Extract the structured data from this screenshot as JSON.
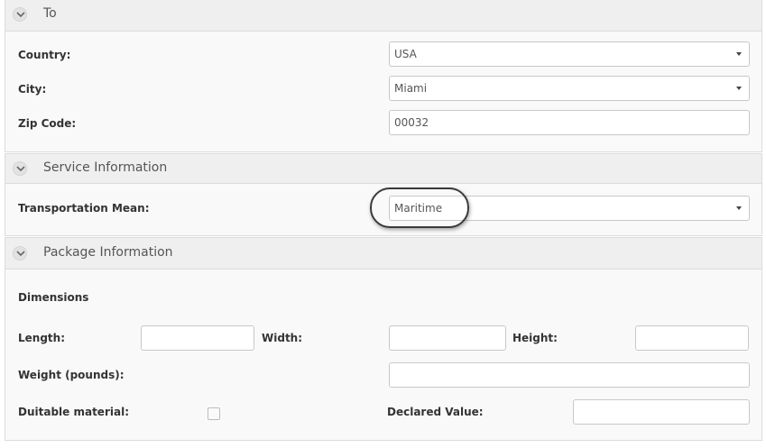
{
  "to_section": {
    "title": "To",
    "country": {
      "label": "Country:",
      "value": "USA"
    },
    "city": {
      "label": "City:",
      "value": "Miami"
    },
    "zip": {
      "label": "Zip Code:",
      "value": "00032"
    }
  },
  "service_section": {
    "title": "Service Information",
    "transport": {
      "label": "Transportation Mean:",
      "value": "Maritime"
    }
  },
  "package_section": {
    "title": "Package Information",
    "dimensions_heading": "Dimensions",
    "length": {
      "label": "Length:",
      "value": ""
    },
    "width": {
      "label": "Width:",
      "value": ""
    },
    "height": {
      "label": "Height:",
      "value": ""
    },
    "weight": {
      "label": "Weight (pounds):",
      "value": ""
    },
    "dutiable": {
      "label": "Duitable material:",
      "checked": false
    },
    "declared_value": {
      "label": "Declared Value:",
      "value": ""
    }
  },
  "icons": {
    "collapse": "chevron-down-icon",
    "dropdown": "caret-down-icon"
  }
}
